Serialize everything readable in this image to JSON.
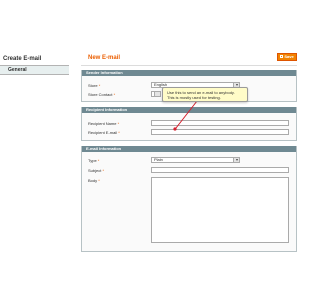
{
  "sidebar": {
    "title": "Create E-mail",
    "tab_label": "General"
  },
  "header": {
    "title": "New E-mail",
    "save_label": "Save"
  },
  "sender_section": {
    "title": "Sender Information",
    "store_label": "Store",
    "store_value": "English",
    "store_contact_label": "Store Contact",
    "store_contact_value": ""
  },
  "recipient_section": {
    "title": "Recipient Information",
    "name_label": "Recipient Name",
    "name_value": "",
    "email_label": "Recipient E-mail",
    "email_value": ""
  },
  "email_section": {
    "title": "E-mail Information",
    "type_label": "Type",
    "type_value": "Plain",
    "subject_label": "Subject",
    "subject_value": "",
    "body_label": "Body",
    "body_value": ""
  },
  "tooltip": {
    "line1": "Use this to send an e-mail to anybody.",
    "line2": "This is mostly used for testing."
  },
  "required_marker": "*",
  "colors": {
    "accent": "#eb5e00",
    "section_header": "#6f8992",
    "tooltip_bg": "#fffcc8",
    "pointer": "#d5202e"
  }
}
